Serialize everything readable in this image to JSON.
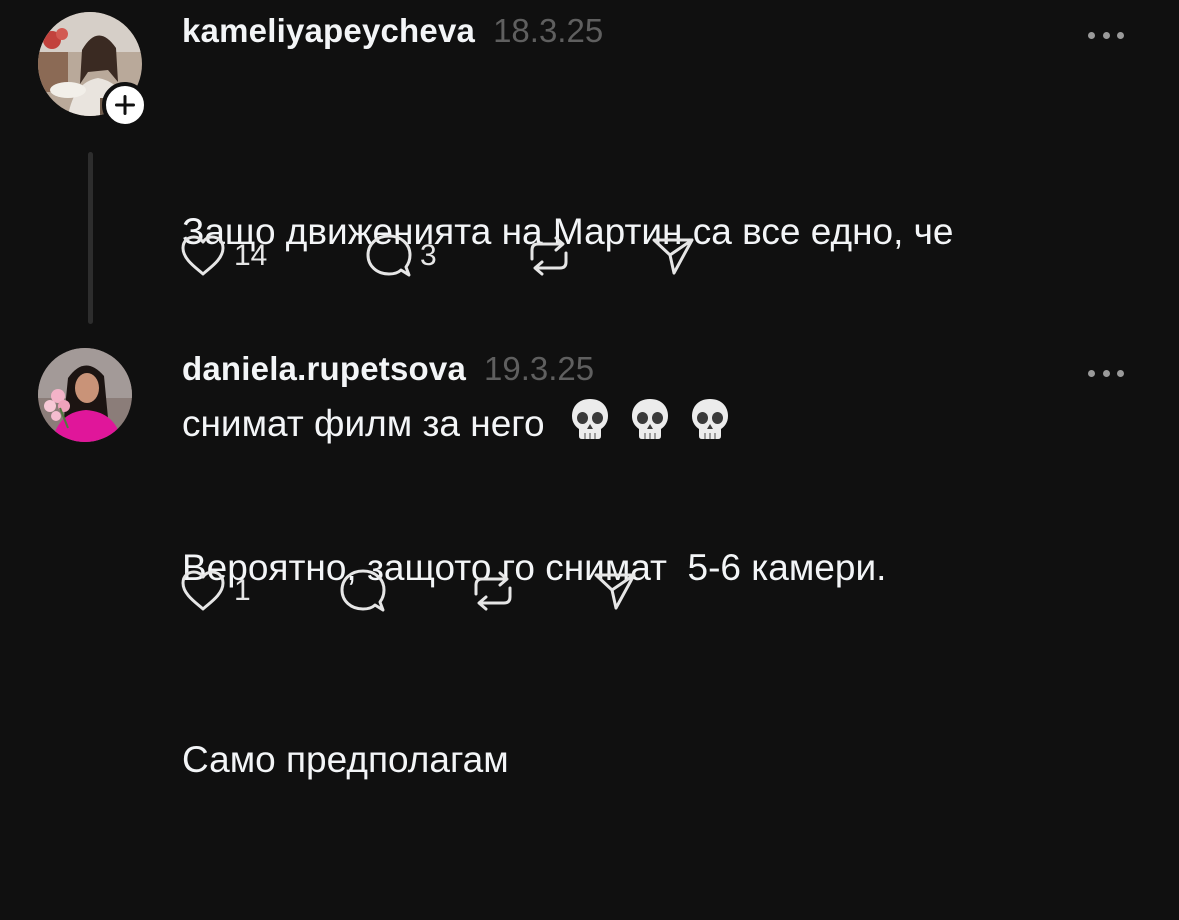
{
  "comments": [
    {
      "username": "kameliyapeycheva",
      "date": "18.3.25",
      "text_line1": "Защо движенията на Мартин са все едно, че",
      "text_line2": "снимат филм за него",
      "emoji_count": 3,
      "likes": "14",
      "replies": "3"
    },
    {
      "username": "daniela.rupetsova",
      "date": "19.3.25",
      "text_line1": "Вероятно, защото го снимат  5-6 камери.",
      "text_line2": "Само предполагам",
      "likes": "1",
      "replies": ""
    }
  ],
  "icons": {
    "like": "heart-icon",
    "reply": "comment-bubble-icon",
    "repost": "repost-icon",
    "share": "send-icon",
    "more": "more-dots-icon",
    "follow": "plus-icon",
    "emoji": "skull-emoji"
  },
  "colors": {
    "background": "#101010",
    "text": "#f3f5f7",
    "secondary": "#5f5f5f",
    "thread_line": "#2d2d2d"
  }
}
